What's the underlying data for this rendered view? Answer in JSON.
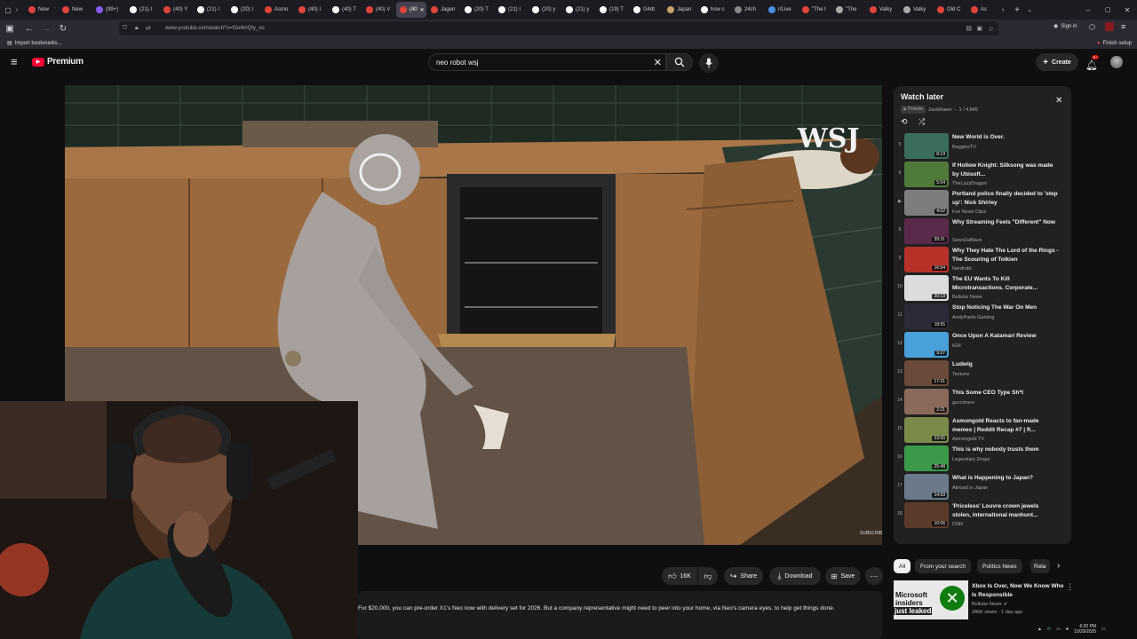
{
  "browser": {
    "tabs": [
      {
        "label": "New",
        "color": "#e0443a"
      },
      {
        "label": "New",
        "color": "#e0443a"
      },
      {
        "label": "(99+)",
        "color": "#8a5cf6"
      },
      {
        "label": "(21) I",
        "color": "#ffffff"
      },
      {
        "label": "(40) Y",
        "color": "#e0443a"
      },
      {
        "label": "(21) I",
        "color": "#ffffff"
      },
      {
        "label": "(20) I",
        "color": "#ffffff"
      },
      {
        "label": "Asmo",
        "color": "#e0443a"
      },
      {
        "label": "(40) I",
        "color": "#e0443a"
      },
      {
        "label": "(40) T",
        "color": "#ffffff"
      },
      {
        "label": "(40) V",
        "color": "#e0443a"
      },
      {
        "label": "(40",
        "color": "#e0443a"
      },
      {
        "label": "Jagen",
        "color": "#e0443a"
      },
      {
        "label": "(20) T",
        "color": "#ffffff"
      },
      {
        "label": "(21) I",
        "color": "#ffffff"
      },
      {
        "label": "(20) y",
        "color": "#ffffff"
      },
      {
        "label": "(21) y",
        "color": "#ffffff"
      },
      {
        "label": "(19) T",
        "color": "#ffffff"
      },
      {
        "label": "G4dt",
        "color": "#ffffff"
      },
      {
        "label": "Japan",
        "color": "#c9a06a"
      },
      {
        "label": "how c",
        "color": "#ffffff"
      },
      {
        "label": "24ch",
        "color": "#888888"
      },
      {
        "label": "r/Live",
        "color": "#4a90e2"
      },
      {
        "label": "\"The I",
        "color": "#e0443a"
      },
      {
        "label": "\"The",
        "color": "#aaaaaa"
      },
      {
        "label": "Valky",
        "color": "#e0443a"
      },
      {
        "label": "Valky",
        "color": "#aaaaaa"
      },
      {
        "label": "Old C",
        "color": "#e0443a"
      },
      {
        "label": "As",
        "color": "#e0443a"
      }
    ],
    "active_tab_index": 11,
    "url": "www.youtube.com/watch?v=f3o4mQty_so",
    "sign_in": "Sign in",
    "bookmarks_label": "Import bookmarks...",
    "finish_setup": "Finish setup"
  },
  "youtube": {
    "logo_text": "Premium",
    "search_value": "neo robot wsj",
    "create_label": "Create",
    "notif_badge": "9+"
  },
  "video": {
    "watermark": "WSJ",
    "small_mark": "SUBSCRIBE",
    "description": "For $20,000, you can pre-order X1's Neo now with delivery set for 2026. But a company representative might need to peer into your home, via Neo's camera eyes, to help get things done."
  },
  "actions": {
    "likes": "16K",
    "share": "Share",
    "download": "Download",
    "save": "Save"
  },
  "playlist": {
    "title": "Watch later",
    "privacy": "Private",
    "owner": "ZackRawrr",
    "position": "1 / 4,845",
    "items": [
      {
        "num": "5",
        "title": "New World is Over.",
        "channel": "BagginsTV",
        "duration": "8:19",
        "thumb": "#3a6e5a"
      },
      {
        "num": "6",
        "title": "If Hollow Knight: Silksong was made by Ubisoft...",
        "channel": "TheLazyDragon",
        "duration": "5:54",
        "thumb": "#4f7a3a"
      },
      {
        "num": "▶",
        "title": "Portland police finally decided to 'step up': Nick Shirley",
        "channel": "Fox News Clips",
        "duration": "4:02",
        "thumb": "#7d7d7d"
      },
      {
        "num": "8",
        "title": "Why Streaming Feels \"Different\" Now",
        "channel": "SeanDaBlack",
        "duration": "39:31",
        "thumb": "#5a2a4a"
      },
      {
        "num": "9",
        "title": "Why They Hate The Lord of the Rings - The Scouring of Tolkien",
        "channel": "Nerdrotic",
        "duration": "16:54",
        "thumb": "#b8322a"
      },
      {
        "num": "10",
        "title": "The EU Wants To Kill Microtransactions. Corporate...",
        "channel": "Bellular News",
        "duration": "20:19",
        "thumb": "#dcdcdc"
      },
      {
        "num": "11",
        "title": "Stop Noticing The War On Men",
        "channel": "AndyPants Gaming",
        "duration": "18:55",
        "thumb": "#2a2a38"
      },
      {
        "num": "12",
        "title": "Once Upon A Katamari Review",
        "channel": "IGN",
        "duration": "9:27",
        "thumb": "#4aa0d8"
      },
      {
        "num": "13",
        "title": "Ludwig",
        "channel": "Tectone",
        "duration": "17:31",
        "thumb": "#6a4a3a"
      },
      {
        "num": "14",
        "title": "This Some CEO Type Sh*t",
        "channel": "guccimarx",
        "duration": "2:21",
        "thumb": "#8a6a5a"
      },
      {
        "num": "15",
        "title": "Asmongold Reacts to fan-made memes | Reddit Recap #7 | ft...",
        "channel": "Asmongold TV",
        "duration": "23:55",
        "thumb": "#7a8a4a"
      },
      {
        "num": "16",
        "title": "This is why nobody trusts them",
        "channel": "Legendary Drops",
        "duration": "25:48",
        "thumb": "#3a9a4a"
      },
      {
        "num": "17",
        "title": "What is Happening to Japan?",
        "channel": "Abroad in Japan",
        "duration": "14:59",
        "thumb": "#6a7a8a"
      },
      {
        "num": "18",
        "title": "'Priceless' Louvre crown jewels stolen, international manhunt...",
        "channel": "CNN",
        "duration": "10:06",
        "thumb": "#5a3a2a"
      }
    ]
  },
  "chips": [
    "All",
    "From your search",
    "Politics News",
    "Rela"
  ],
  "recommendation": {
    "title": "Xbox Is Over, Now We Know Who Is Responsible",
    "channel": "Bellular News",
    "meta": "286K views · 1 day ago",
    "thumb_line1": "Microsoft",
    "thumb_line2": "insiders",
    "thumb_line3": "just leaked",
    "thumb_color": "#107c10"
  },
  "taskbar": {
    "time": "6:20 PM",
    "date": "10/29/2025"
  }
}
